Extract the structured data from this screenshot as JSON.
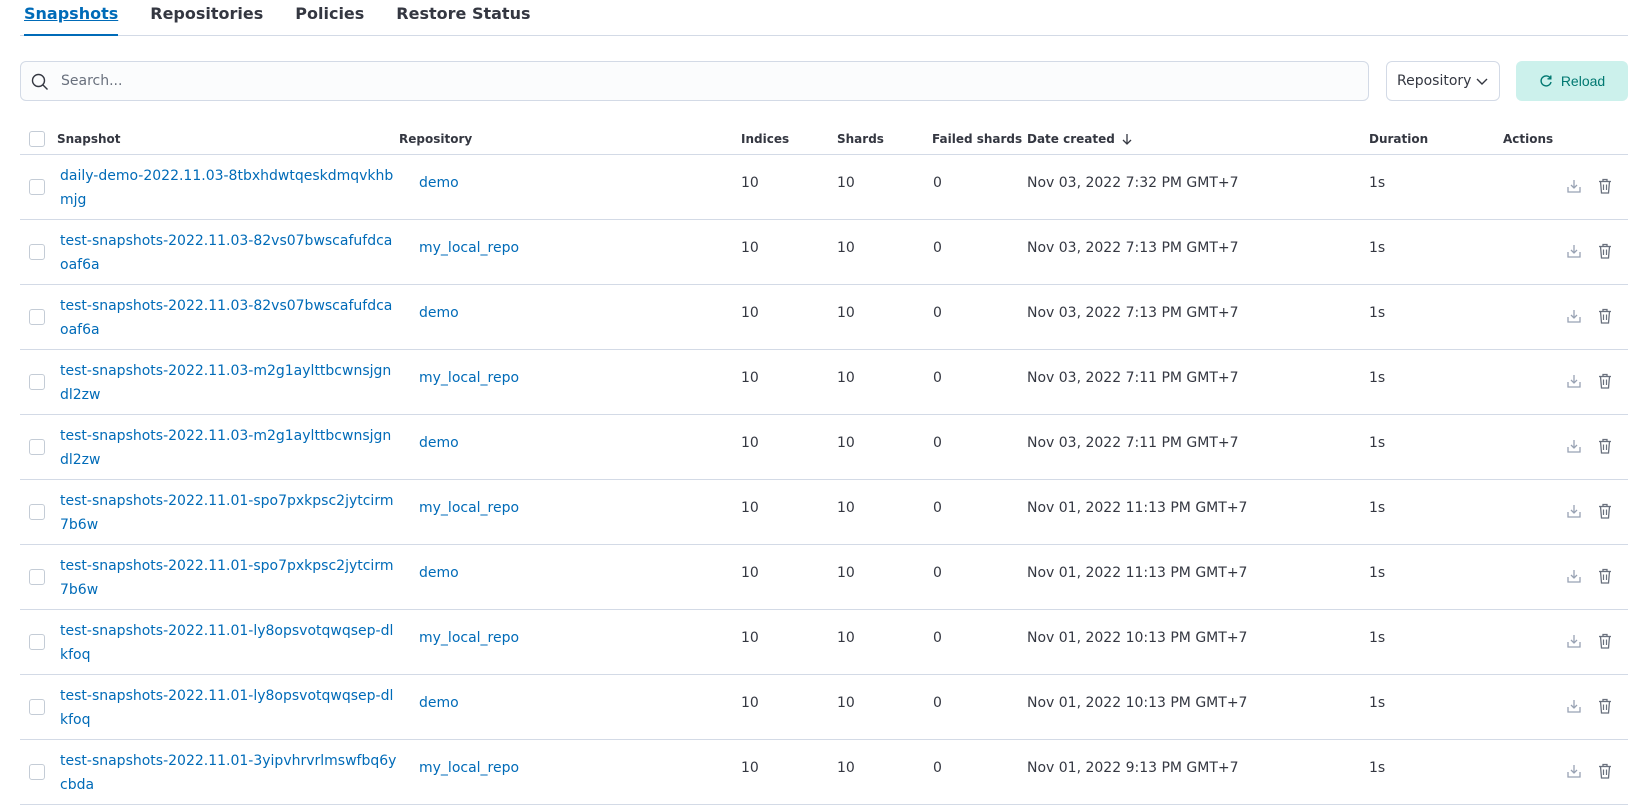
{
  "tabs": [
    {
      "label": "Snapshots"
    },
    {
      "label": "Repositories"
    },
    {
      "label": "Policies"
    },
    {
      "label": "Restore Status"
    }
  ],
  "search": {
    "placeholder": "Search...",
    "icon": "search-icon"
  },
  "repository_filter": {
    "label": "Repository",
    "icon": "chevron-down-icon"
  },
  "reload": {
    "label": "Reload",
    "icon": "refresh-icon"
  },
  "table": {
    "columns": {
      "snapshot": "Snapshot",
      "repository": "Repository",
      "indices": "Indices",
      "shards": "Shards",
      "failed": "Failed shards",
      "date": "Date created",
      "duration": "Duration",
      "actions": "Actions"
    },
    "sort_icon": "arrow-down-icon",
    "action_icons": [
      "restore-icon",
      "trash-icon"
    ],
    "rows": [
      {
        "snapshot": "daily-demo-2022.11.03-8tbxhdwtqeskdmqvkhbmjg",
        "repo": "demo",
        "indices": "10",
        "shards": "10",
        "failed": "0",
        "date": "Nov 03, 2022 7:32 PM GMT+7",
        "duration": "1s"
      },
      {
        "snapshot": "test-snapshots-2022.11.03-82vs07bwscafufdcaoaf6a",
        "repo": "my_local_repo",
        "indices": "10",
        "shards": "10",
        "failed": "0",
        "date": "Nov 03, 2022 7:13 PM GMT+7",
        "duration": "1s"
      },
      {
        "snapshot": "test-snapshots-2022.11.03-82vs07bwscafufdcaoaf6a",
        "repo": "demo",
        "indices": "10",
        "shards": "10",
        "failed": "0",
        "date": "Nov 03, 2022 7:13 PM GMT+7",
        "duration": "1s"
      },
      {
        "snapshot": "test-snapshots-2022.11.03-m2g1aylttbcwnsjgndl2zw",
        "repo": "my_local_repo",
        "indices": "10",
        "shards": "10",
        "failed": "0",
        "date": "Nov 03, 2022 7:11 PM GMT+7",
        "duration": "1s"
      },
      {
        "snapshot": "test-snapshots-2022.11.03-m2g1aylttbcwnsjgndl2zw",
        "repo": "demo",
        "indices": "10",
        "shards": "10",
        "failed": "0",
        "date": "Nov 03, 2022 7:11 PM GMT+7",
        "duration": "1s"
      },
      {
        "snapshot": "test-snapshots-2022.11.01-spo7pxkpsc2jytcirm7b6w",
        "repo": "my_local_repo",
        "indices": "10",
        "shards": "10",
        "failed": "0",
        "date": "Nov 01, 2022 11:13 PM GMT+7",
        "duration": "1s"
      },
      {
        "snapshot": "test-snapshots-2022.11.01-spo7pxkpsc2jytcirm7b6w",
        "repo": "demo",
        "indices": "10",
        "shards": "10",
        "failed": "0",
        "date": "Nov 01, 2022 11:13 PM GMT+7",
        "duration": "1s"
      },
      {
        "snapshot": "test-snapshots-2022.11.01-ly8opsvotqwqsep-dlkfoq",
        "repo": "my_local_repo",
        "indices": "10",
        "shards": "10",
        "failed": "0",
        "date": "Nov 01, 2022 10:13 PM GMT+7",
        "duration": "1s"
      },
      {
        "snapshot": "test-snapshots-2022.11.01-ly8opsvotqwqsep-dlkfoq",
        "repo": "demo",
        "indices": "10",
        "shards": "10",
        "failed": "0",
        "date": "Nov 01, 2022 10:13 PM GMT+7",
        "duration": "1s"
      },
      {
        "snapshot": "test-snapshots-2022.11.01-3yipvhrvrlmswfbq6ycbda",
        "repo": "my_local_repo",
        "indices": "10",
        "shards": "10",
        "failed": "0",
        "date": "Nov 01, 2022 9:13 PM GMT+7",
        "duration": "1s"
      }
    ]
  }
}
